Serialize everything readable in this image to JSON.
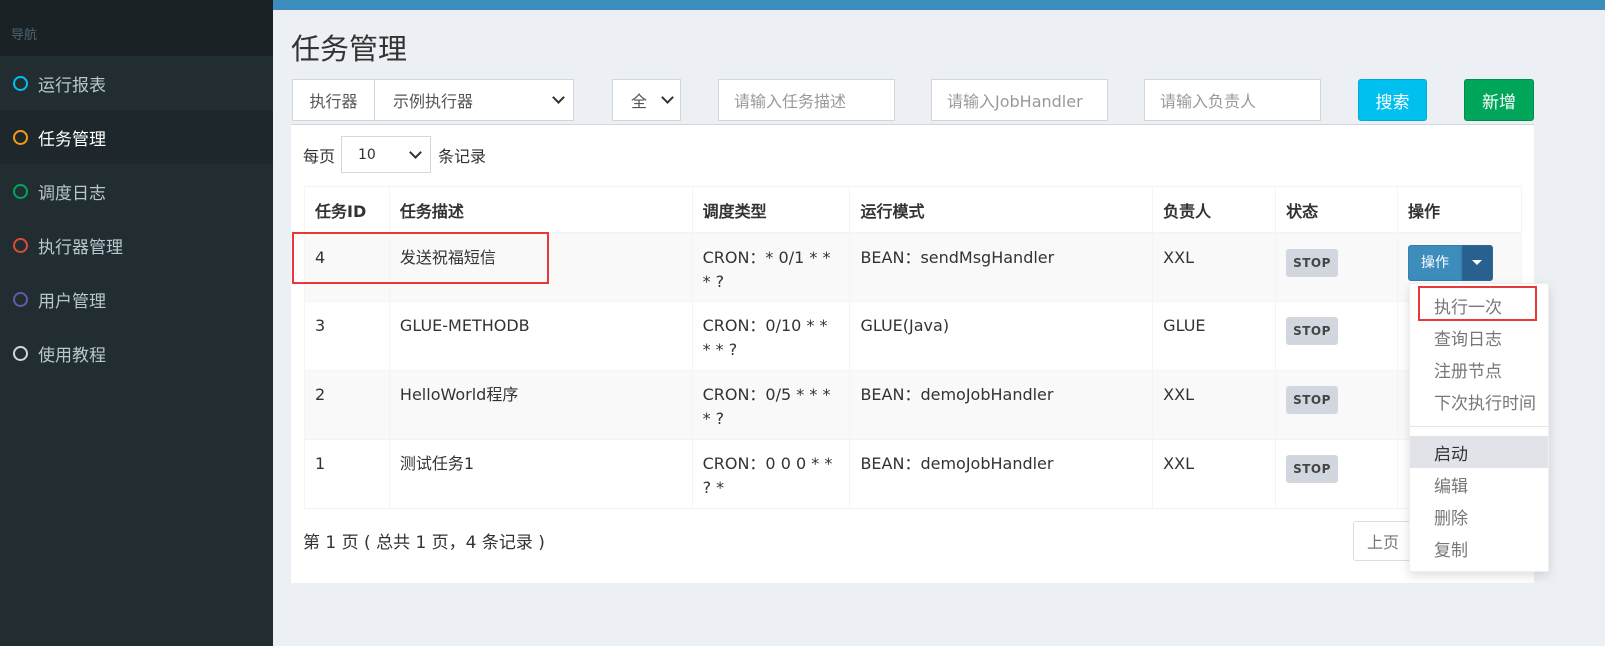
{
  "sidebar": {
    "header": "导航",
    "items": [
      {
        "label": "运行报表",
        "color": "#00c0ef"
      },
      {
        "label": "任务管理",
        "color": "#f39c12"
      },
      {
        "label": "调度日志",
        "color": "#00a65a"
      },
      {
        "label": "执行器管理",
        "color": "#dd4b39"
      },
      {
        "label": "用户管理",
        "color": "#605ca8"
      },
      {
        "label": "使用教程",
        "color": "#d2d6de"
      }
    ],
    "active_index": 1
  },
  "page": {
    "title": "任务管理"
  },
  "filters": {
    "executor_label": "执行器",
    "executor_value": "示例执行器",
    "status_value": "全",
    "desc_placeholder": "请输入任务描述",
    "handler_placeholder": "请输入JobHandler",
    "author_placeholder": "请输入负责人",
    "search_label": "搜索",
    "add_label": "新增"
  },
  "page_length": {
    "prefix": "每页",
    "value": "10",
    "suffix": "条记录"
  },
  "table": {
    "headers": [
      "任务ID",
      "任务描述",
      "调度类型",
      "运行模式",
      "负责人",
      "状态",
      "操作"
    ],
    "rows": [
      {
        "id": "4",
        "desc": "发送祝福短信",
        "schedule": "CRON：* 0/1 * * * ?",
        "mode": "BEAN：sendMsgHandler",
        "author": "XXL",
        "status": "STOP",
        "op": "操作"
      },
      {
        "id": "3",
        "desc": "GLUE-METHODB",
        "schedule": "CRON：0/10 * * * * ?",
        "mode": "GLUE(Java)",
        "author": "GLUE",
        "status": "STOP",
        "op": ""
      },
      {
        "id": "2",
        "desc": "HelloWorld程序",
        "schedule": "CRON：0/5 * * * * ?",
        "mode": "BEAN：demoJobHandler",
        "author": "XXL",
        "status": "STOP",
        "op": ""
      },
      {
        "id": "1",
        "desc": "测试任务1",
        "schedule": "CRON：0 0 0 * * ? *",
        "mode": "BEAN：demoJobHandler",
        "author": "XXL",
        "status": "STOP",
        "op": ""
      }
    ]
  },
  "footer": {
    "info": "第 1 页 ( 总共 1 页，4 条记录 )",
    "prev": "上页"
  },
  "dropdown": {
    "group1": [
      "执行一次",
      "查询日志",
      "注册节点",
      "下次执行时间"
    ],
    "group2": [
      "启动",
      "编辑",
      "删除",
      "复制"
    ]
  },
  "colors": {
    "search": "#00c0ef",
    "add": "#00a65a",
    "primary": "#3c8dbc",
    "highlight": "#e83838"
  }
}
